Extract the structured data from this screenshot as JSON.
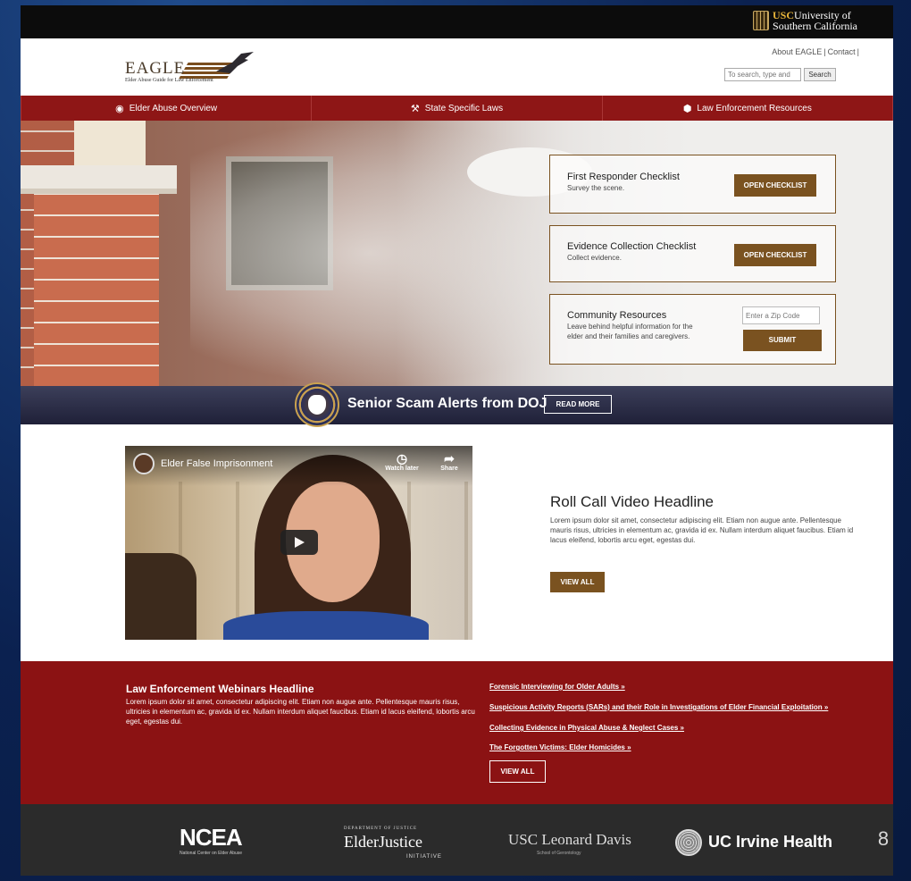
{
  "topbar": {
    "usc_abbr": "USC",
    "usc_line1": "University of",
    "usc_line2": "Southern California"
  },
  "header": {
    "logo_word": "EAGLE",
    "logo_sub": "Elder Abuse Guide for Law Enforcement",
    "about_link": "About EAGLE",
    "contact_link": "Contact",
    "search_placeholder": "To search, type and",
    "search_button": "Search"
  },
  "nav": {
    "items": [
      {
        "label": "Elder Abuse Overview",
        "icon": "eye-icon"
      },
      {
        "label": "State Specific Laws",
        "icon": "gavel-icon"
      },
      {
        "label": "Law Enforcement Resources",
        "icon": "badge-icon"
      }
    ]
  },
  "hero": {
    "cards": [
      {
        "title": "First Responder Checklist",
        "subtitle": "Survey the scene.",
        "button": "OPEN CHECKLIST"
      },
      {
        "title": "Evidence Collection Checklist",
        "subtitle": "Collect evidence.",
        "button": "OPEN CHECKLIST"
      },
      {
        "title": "Community Resources",
        "subtitle_line1": "Leave behind helpful information for the",
        "subtitle_line2": "elder and their families and caregivers.",
        "zip_placeholder": "Enter a Zip Code",
        "button": "SUBMIT"
      }
    ]
  },
  "alert": {
    "text": "Senior Scam Alerts from DOJ",
    "button": "READ MORE"
  },
  "video": {
    "title": "Elder False Imprisonment",
    "watch_later": "Watch later",
    "share": "Share"
  },
  "rollcall": {
    "title": "Roll Call Video Headline",
    "body": "Lorem ipsum dolor sit amet, consectetur adipiscing elit. Etiam non augue ante. Pellentesque mauris risus, ultricies in elementum ac, gravida id ex. Nullam interdum aliquet faucibus. Etiam id lacus eleifend, lobortis arcu eget, egestas dui.",
    "button": "VIEW ALL"
  },
  "webinars": {
    "title": "Law Enforcement Webinars Headline",
    "body": "Lorem ipsum dolor sit amet, consectetur adipiscing elit. Etiam non augue ante. Pellentesque mauris risus, ultricies in elementum ac, gravida id ex. Nullam interdum aliquet faucibus. Etiam id lacus eleifend, lobortis arcu eget, egestas dui.",
    "links": [
      "Forensic Interviewing for Older Adults »",
      "Suspicious Activity Reports (SARs) and their Role in Investigations of Elder Financial Exploitation »",
      "Collecting Evidence in Physical Abuse & Neglect Cases »",
      "The Forgotten Victims: Elder Homicides »"
    ],
    "button": "VIEW ALL"
  },
  "partners": {
    "ncea": "NCEA",
    "ncea_sub": "National Center on Elder Abuse",
    "ej_top": "DEPARTMENT OF JUSTICE",
    "ej_name": "ElderJustice",
    "ej_sub": "INITIATIVE",
    "usc": "USC Leonard Davis",
    "usc_sub": "School of Gerontology",
    "uci": "UC Irvine Health"
  },
  "slide_number": "8",
  "colors": {
    "maroon": "#8e1616",
    "brown": "#7a5220",
    "navy_bg": "#0d2350",
    "footer": "#2b2b2b"
  }
}
